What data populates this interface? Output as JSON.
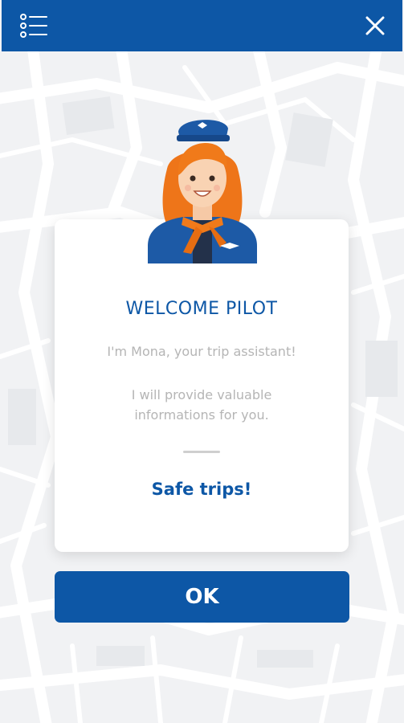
{
  "welcome": {
    "title": "WELCOME PILOT",
    "intro": "I'm Mona, your trip assistant!",
    "info": "I will provide valuable informations for you.",
    "farewell": "Safe trips!"
  },
  "actions": {
    "ok_label": "OK"
  },
  "icons": {
    "menu": "list-menu-icon",
    "close": "close-icon",
    "avatar": "flight-attendant-avatar"
  },
  "colors": {
    "primary": "#0d57a6",
    "avatar_hair": "#f07a1a",
    "muted_text": "#b5b5b5"
  }
}
